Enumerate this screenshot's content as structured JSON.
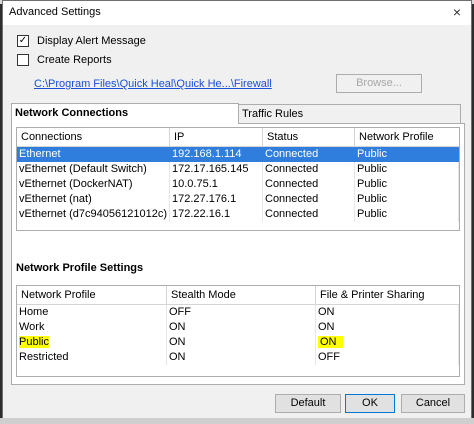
{
  "window": {
    "title": "Advanced Settings",
    "close_label": "×"
  },
  "options": {
    "display_alert": {
      "label": "Display Alert Message",
      "checked": true,
      "mark": "✓"
    },
    "create_reports": {
      "label": "Create Reports",
      "checked": false,
      "mark": ""
    },
    "path": "C:\\Program Files\\Quick Heal\\Quick He...\\Firewall",
    "browse_label": "Browse..."
  },
  "tabs": [
    {
      "label": "Network Connections",
      "active": true
    },
    {
      "label": "Traffic Rules",
      "active": false
    }
  ],
  "connections": {
    "columns": [
      "Connections",
      "IP",
      "Status",
      "Network Profile"
    ],
    "rows": [
      {
        "name": "Ethernet",
        "ip": "192.168.1.114",
        "status": "Connected",
        "profile": "Public",
        "selected": true
      },
      {
        "name": "vEthernet (Default Switch)",
        "ip": "172.17.165.145",
        "status": "Connected",
        "profile": "Public",
        "selected": false
      },
      {
        "name": "vEthernet (DockerNAT)",
        "ip": "10.0.75.1",
        "status": "Connected",
        "profile": "Public",
        "selected": false
      },
      {
        "name": "vEthernet (nat)",
        "ip": "172.27.176.1",
        "status": "Connected",
        "profile": "Public",
        "selected": false
      },
      {
        "name": "vEthernet (d7c94056121012c)",
        "ip": "172.22.16.1",
        "status": "Connected",
        "profile": "Public",
        "selected": false
      }
    ]
  },
  "profile_settings": {
    "title": "Network Profile Settings",
    "columns": [
      "Network Profile",
      "Stealth Mode",
      "File & Printer Sharing"
    ],
    "rows": [
      {
        "profile": "Home",
        "stealth": "OFF",
        "sharing": "ON"
      },
      {
        "profile": "Work",
        "stealth": "ON",
        "sharing": "ON"
      },
      {
        "profile": "Public",
        "stealth": "ON",
        "sharing": "ON"
      },
      {
        "profile": "Restricted",
        "stealth": "ON",
        "sharing": "OFF"
      }
    ],
    "highlight_color": "#ffff00"
  },
  "buttons": {
    "default": "Default",
    "ok": "OK",
    "cancel": "Cancel"
  },
  "colors": {
    "selection": "#2f7ddc",
    "link": "#1a4fd8"
  }
}
